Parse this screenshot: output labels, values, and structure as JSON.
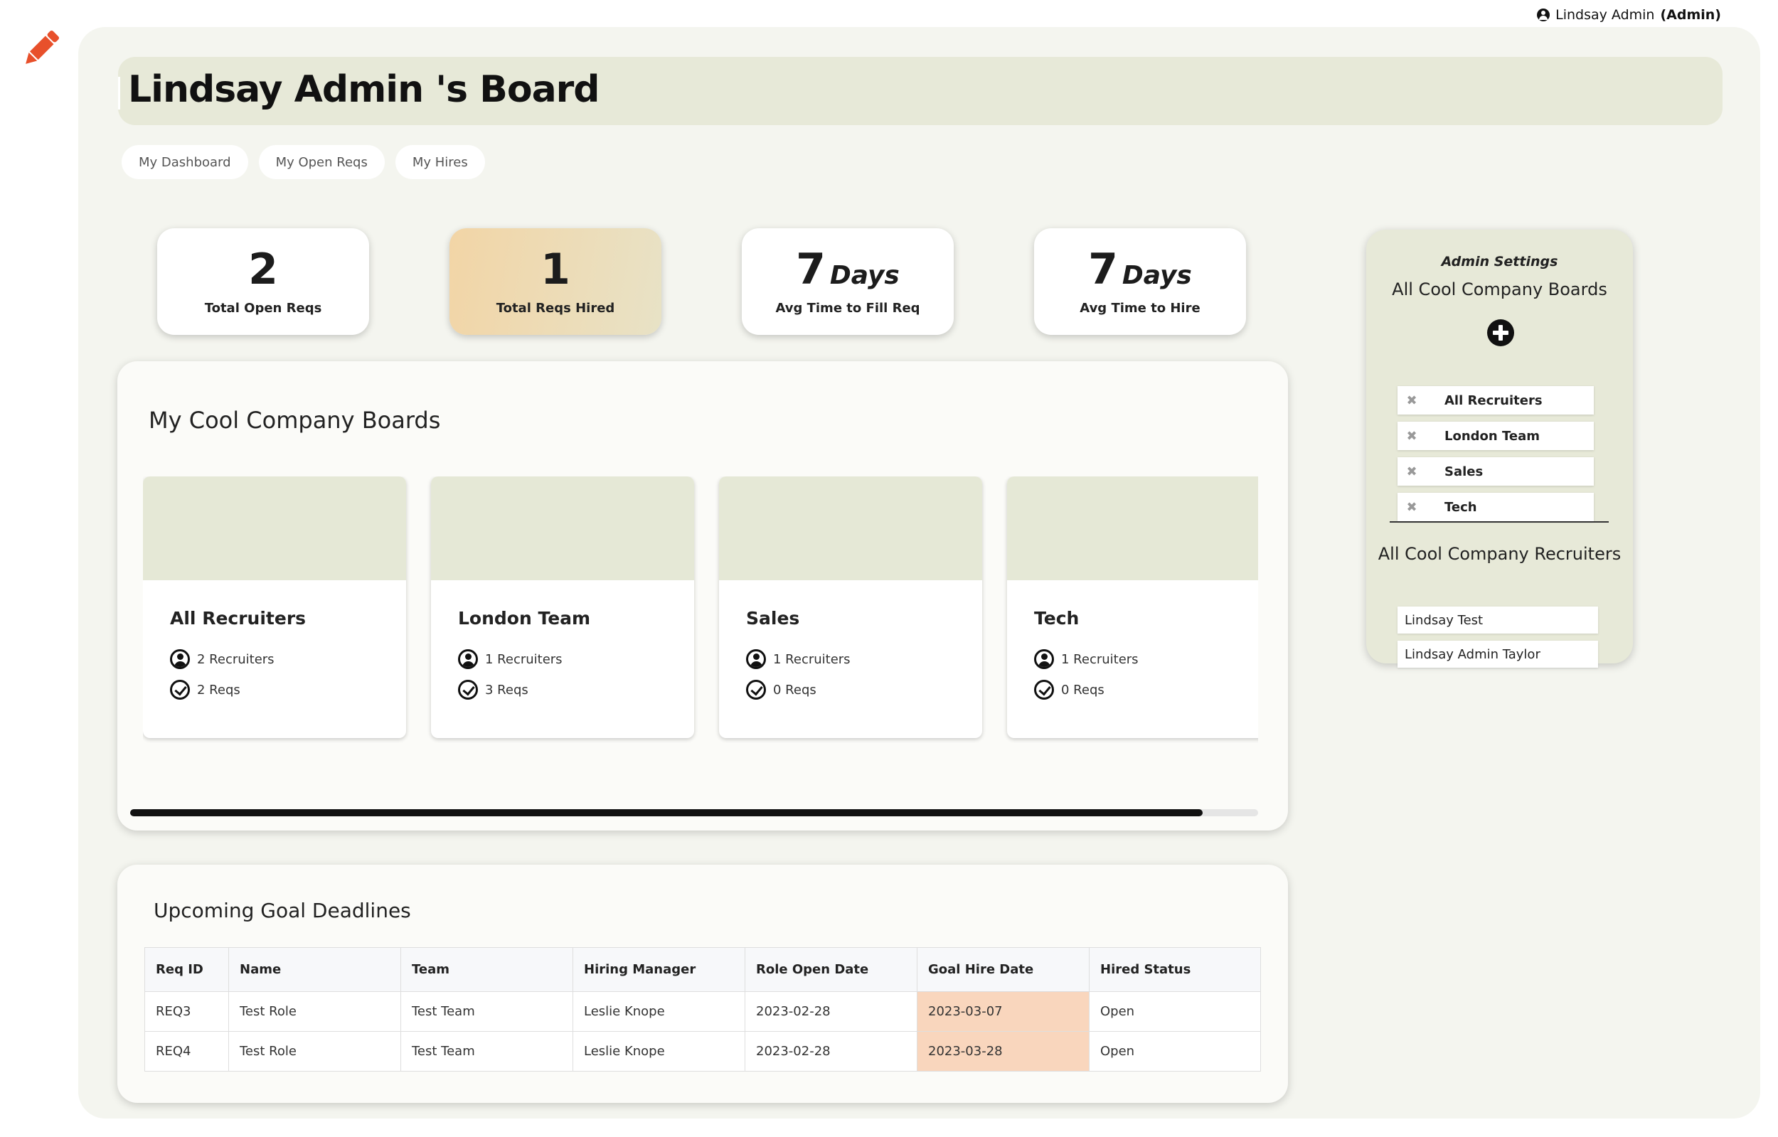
{
  "user": {
    "name": "Lindsay Admin",
    "role": "(Admin)"
  },
  "page": {
    "title": "Lindsay Admin 's Board"
  },
  "tabs": [
    {
      "label": "My Dashboard"
    },
    {
      "label": "My Open Reqs"
    },
    {
      "label": "My Hires"
    }
  ],
  "stats": {
    "open_reqs": {
      "value": "2",
      "label": "Total Open Reqs"
    },
    "reqs_hired": {
      "value": "1",
      "label": "Total Reqs Hired"
    },
    "time_to_fill": {
      "value": "7",
      "unit": "Days",
      "label": "Avg Time to Fill Req"
    },
    "time_to_hire": {
      "value": "7",
      "unit": "Days",
      "label": "Avg Time to Hire"
    }
  },
  "boards": {
    "title": "My Cool Company Boards",
    "items": [
      {
        "name": "All Recruiters",
        "recruiters": "2 Recruiters",
        "reqs": "2 Reqs"
      },
      {
        "name": "London Team",
        "recruiters": "1 Recruiters",
        "reqs": "3 Reqs"
      },
      {
        "name": "Sales",
        "recruiters": "1 Recruiters",
        "reqs": "0 Reqs"
      },
      {
        "name": "Tech",
        "recruiters": "1 Recruiters",
        "reqs": "0 Reqs"
      }
    ]
  },
  "goals": {
    "title": "Upcoming Goal Deadlines",
    "columns": [
      "Req ID",
      "Name",
      "Team",
      "Hiring Manager",
      "Role Open Date",
      "Goal Hire Date",
      "Hired Status"
    ],
    "rows": [
      [
        "REQ3",
        "Test Role",
        "Test Team",
        "Leslie Knope",
        "2023-02-28",
        "2023-03-07",
        "Open"
      ],
      [
        "REQ4",
        "Test Role",
        "Test Team",
        "Leslie Knope",
        "2023-02-28",
        "2023-03-28",
        "Open"
      ]
    ]
  },
  "admin": {
    "title": "Admin Settings",
    "boards_title": "All Cool Company Boards",
    "boards": [
      "All Recruiters",
      "London Team",
      "Sales",
      "Tech"
    ],
    "recruiters_title": "All Cool Company Recruiters",
    "recruiters": [
      "Lindsay Test",
      "Lindsay Admin Taylor"
    ]
  },
  "colors": {
    "background": "#f4f5ef",
    "accent_panel": "#e7e9d8",
    "highlight_date": "#f9d6bd",
    "logo": "#e8502b"
  }
}
